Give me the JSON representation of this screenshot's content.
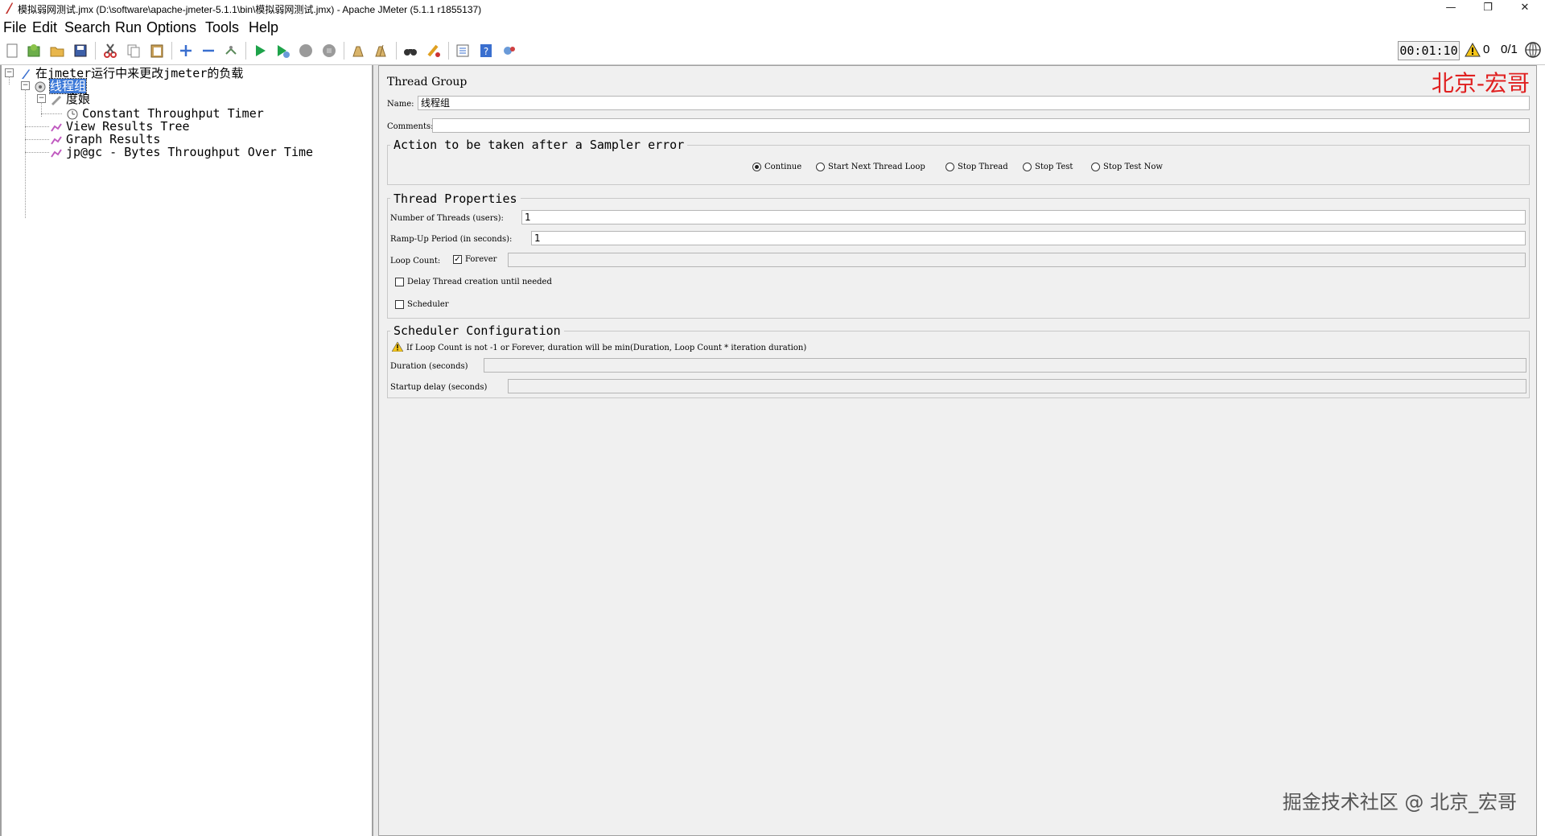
{
  "window": {
    "title": "模拟弱网测试.jmx (D:\\software\\apache-jmeter-5.1.1\\bin\\模拟弱网测试.jmx) - Apache JMeter (5.1.1 r1855137)",
    "minimize": "—",
    "restore": "❐",
    "close": "✕"
  },
  "menu": {
    "file": "File",
    "edit": "Edit",
    "search": "Search",
    "run": "Run",
    "options": "Options",
    "tools": "Tools",
    "help": "Help"
  },
  "toolbar": {
    "icons": [
      "new-icon",
      "templates-icon",
      "open-icon",
      "save-icon",
      "cut-icon",
      "copy-icon",
      "paste-icon",
      "expand-icon",
      "collapse-icon",
      "toggle-icon",
      "start-icon",
      "start-no-pause-icon",
      "stop-icon",
      "shutdown-icon",
      "clear-icon",
      "clear-all-icon",
      "search-icon",
      "reset-search-icon",
      "function-helper-icon",
      "help-icon",
      "remote-icon"
    ],
    "elapsed_time": "00:01:10",
    "warning_count": "0",
    "threads": "0/1"
  },
  "tree": {
    "root": "在jmeter运行中来更改jmeter的负载",
    "thread_group": "线程组",
    "controller": "度娘",
    "timer": "Constant Throughput Timer",
    "listener1": "View Results Tree",
    "listener2": "Graph Results",
    "listener3": "jp@gc - Bytes Throughput Over Time"
  },
  "panel": {
    "title": "Thread Group",
    "watermark_top": "北京-宏哥",
    "name_label": "Name:",
    "name_value": "线程组",
    "comments_label": "Comments:",
    "comments_value": "",
    "sampler_error": {
      "title": "Action to be taken after a Sampler error",
      "options": [
        "Continue",
        "Start Next Thread Loop",
        "Stop Thread",
        "Stop Test",
        "Stop Test Now"
      ],
      "selected": "Continue"
    },
    "thread_props": {
      "title": "Thread Properties",
      "threads_label": "Number of Threads (users):",
      "threads_value": "1",
      "rampup_label": "Ramp-Up Period (in seconds):",
      "rampup_value": "1",
      "loop_label": "Loop Count:",
      "forever_label": "Forever",
      "forever_checked": true,
      "loop_value": "",
      "delay_label": "Delay Thread creation until needed",
      "scheduler_label": "Scheduler"
    },
    "scheduler_config": {
      "title": "Scheduler Configuration",
      "note": "If Loop Count is not -1 or Forever, duration will be min(Duration, Loop Count * iteration duration)",
      "duration_label": "Duration (seconds)",
      "duration_value": "",
      "startup_label": "Startup delay (seconds)",
      "startup_value": ""
    },
    "watermark_bottom": "掘金技术社区 @ 北京_宏哥"
  }
}
